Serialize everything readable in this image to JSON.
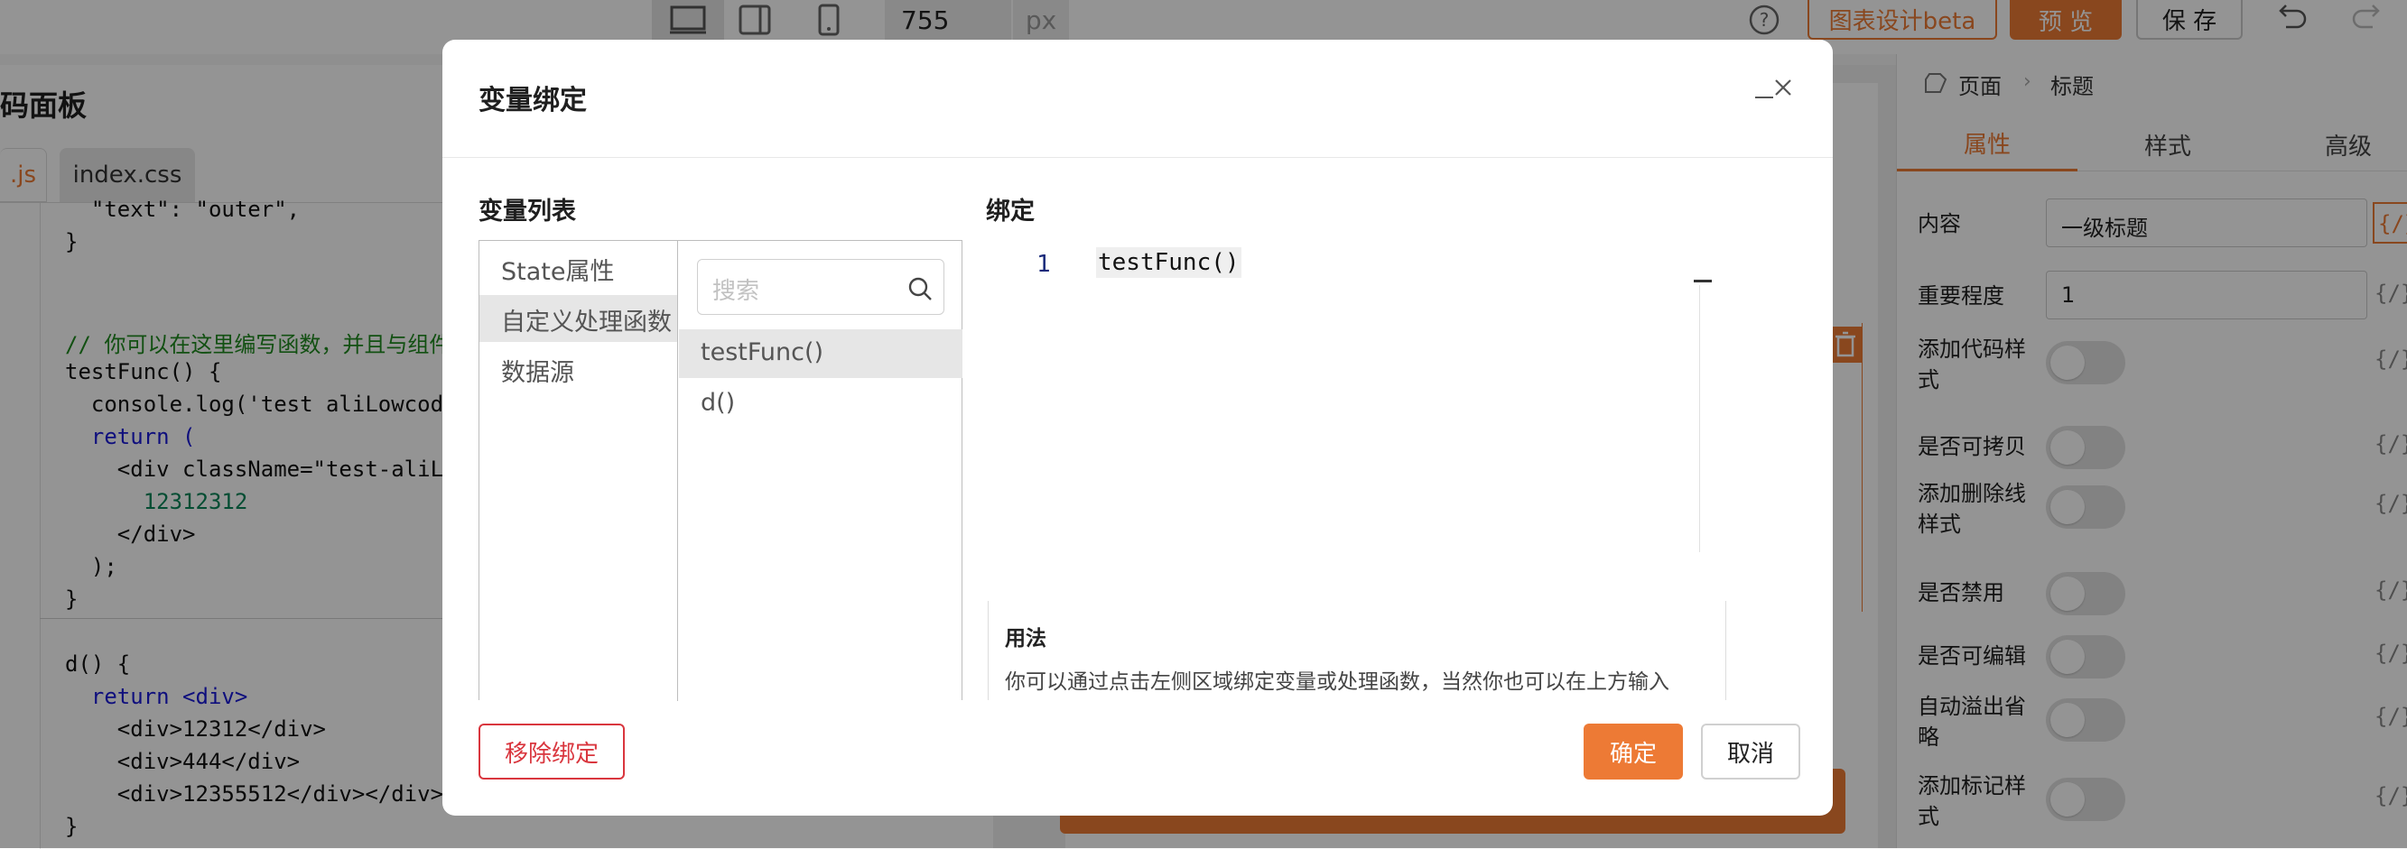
{
  "toolbar": {
    "width_value": "755",
    "width_unit": "px",
    "chart_design_label": "图表设计beta",
    "preview_label": "预 览",
    "save_label": "保 存"
  },
  "code_panel": {
    "title": "码面板",
    "tabs": [
      ".js",
      "index.css"
    ],
    "lines": [
      "  \"text\": \"outer\",",
      "}",
      "",
      "",
      "// 你可以在这里编写函数，并且与组件",
      "testFunc() {",
      "  console.log('test aliLowcod",
      "  return (",
      "    <div className=\"test-aliL",
      "      12312312",
      "    </div>",
      "  );",
      "}",
      "",
      "d() {",
      "  return <div>",
      "    <div>12312</div>",
      "    <div>444</div>",
      "    <div>12355512</div></div>",
      "}"
    ]
  },
  "settings": {
    "breadcrumb_root": "页面",
    "breadcrumb_current": "标题",
    "tabs": [
      "属性",
      "样式",
      "高级"
    ],
    "props": [
      {
        "label": "内容",
        "value": "一级标题"
      },
      {
        "label": "重要程度",
        "value": "1"
      },
      {
        "label": "添加代码样式"
      },
      {
        "label": "是否可拷贝"
      },
      {
        "label": "添加删除线样式"
      },
      {
        "label": "是否禁用"
      },
      {
        "label": "是否可编辑"
      },
      {
        "label": "自动溢出省略"
      },
      {
        "label": "添加标记样式"
      }
    ],
    "bind_icon": "{/}"
  },
  "dialog": {
    "title": "变量绑定",
    "var_list_title": "变量列表",
    "categories": [
      "State属性",
      "自定义处理函数",
      "数据源"
    ],
    "search_placeholder": "搜索",
    "functions": [
      "testFunc()",
      "d()"
    ],
    "bind_title": "绑定",
    "editor_line_number": "1",
    "editor_code": "testFunc()",
    "usage_title": "用法",
    "usage_text": "你可以通过点击左侧区域绑定变量或处理函数，当然你也可以在上方输入",
    "remove_label": "移除绑定",
    "confirm_label": "确定",
    "cancel_label": "取消"
  },
  "colors": {
    "accent": "#ed7a35",
    "danger": "#d9363e"
  }
}
